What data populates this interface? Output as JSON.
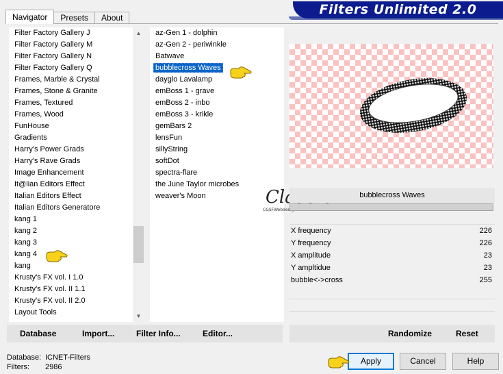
{
  "tabs": [
    "Navigator",
    "Presets",
    "About"
  ],
  "banner": "Filters Unlimited 2.0",
  "categories": [
    "Filter Factory Gallery J",
    "Filter Factory Gallery M",
    "Filter Factory Gallery N",
    "Filter Factory Gallery Q",
    "Frames, Marble & Crystal",
    "Frames, Stone & Granite",
    "Frames, Textured",
    "Frames, Wood",
    "FunHouse",
    "Gradients",
    "Harry's Power Grads",
    "Harry's Rave Grads",
    "Image Enhancement",
    "It@lian Editors Effect",
    "Italian Editors Effect",
    "Italian Editors Generatore",
    "kang 1",
    "kang 2",
    "kang 3",
    "kang 4",
    "kang",
    "Krusty's FX vol. I 1.0",
    "Krusty's FX vol. II 1.1",
    "Krusty's FX vol. II 2.0",
    "Layout Tools"
  ],
  "filters": [
    "az-Gen 1  -  dolphin",
    "az-Gen 2  -  periwinkle",
    "Batwave",
    "bubblecross Waves",
    "dayglo Lavalamp",
    "emBoss 1  -  grave",
    "emBoss 2  -  inbo",
    "emBoss 3  -  krikle",
    "gemBars 2",
    "lensFun",
    "sillyString",
    "softDot",
    "spectra-flare",
    "the June Taylor microbes",
    "weaver's Moon"
  ],
  "selected_filter_index": 3,
  "left_buttons": {
    "database": "Database",
    "import": "Import...",
    "filter_info": "Filter Info...",
    "editor": "Editor..."
  },
  "filter_title": "bubblecross Waves",
  "params": [
    {
      "label": "X frequency",
      "value": "226"
    },
    {
      "label": "Y frequency",
      "value": "226"
    },
    {
      "label": "X amplitude",
      "value": "23"
    },
    {
      "label": "Y ampltidue",
      "value": "23"
    },
    {
      "label": "bubble<->cross",
      "value": "255"
    }
  ],
  "right_buttons": {
    "randomize": "Randomize",
    "reset": "Reset"
  },
  "footer": {
    "database_label": "Database:",
    "database_value": "ICNET-Filters",
    "filters_label": "Filters:",
    "filters_value": "2986"
  },
  "dialog_buttons": {
    "apply": "Apply",
    "cancel": "Cancel",
    "help": "Help"
  },
  "watermark": {
    "text": "Claudia",
    "subtext": "CGSFWebdesign"
  },
  "colors": {
    "banner": "#0c1c8e",
    "selection": "#0a64c9",
    "checker": "#fbc2c2",
    "hand": "#f7d21a"
  }
}
